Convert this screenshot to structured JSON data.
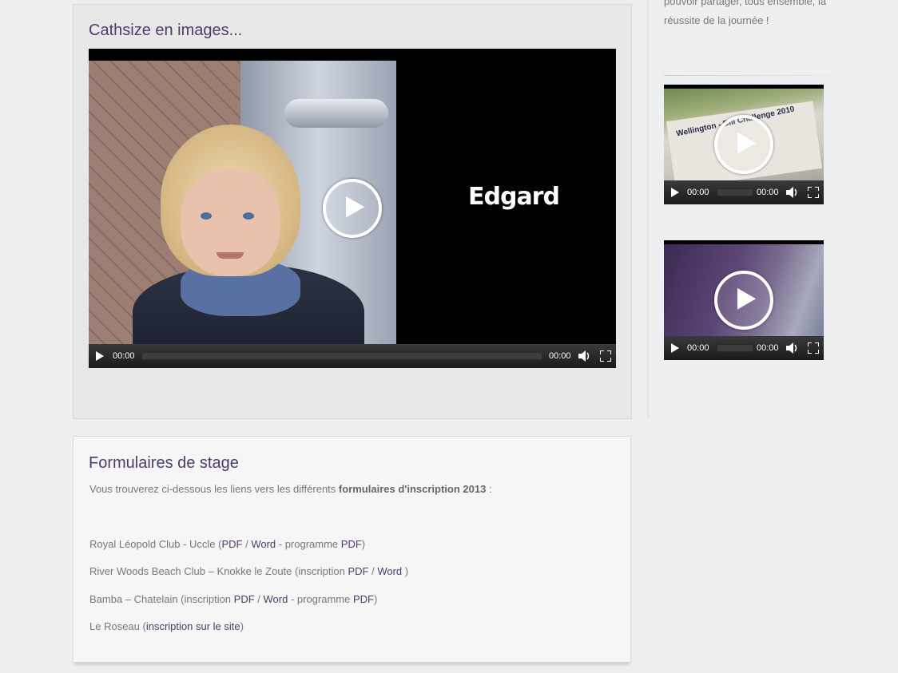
{
  "sidebar": {
    "text_lines": [
      "pouvoir partager, tous ensemble, la",
      "réussite de la journée !"
    ]
  },
  "video_section": {
    "title": "Cathsize en images...",
    "main_video": {
      "overlay_name": "Edgard",
      "current_time": "00:00",
      "duration": "00:00",
      "progress": 0
    }
  },
  "thumbnails": [
    {
      "banner_text": "Wellington - Bill Challenge 2010",
      "current_time": "00:00",
      "duration": "00:00"
    },
    {
      "current_time": "00:00",
      "duration": "00:00"
    }
  ],
  "forms_section": {
    "title": "Formulaires de stage",
    "intro_text": "Vous trouverez ci-dessous les liens vers les différents ",
    "intro_bold": "formulaires d'inscription 2013",
    "intro_end": " :",
    "lines": [
      {
        "prefix": "Royal Léopold Club - Uccle (",
        "link1": "PDF",
        "sep1": " / ",
        "link2": "Word",
        "mid": " - programme ",
        "link3": "PDF",
        "suffix": ")"
      },
      {
        "prefix": "River Woods Beach Club – Knokke le Zoute (inscription ",
        "link1": "PDF",
        "sep1": " / ",
        "link2": "Word",
        "suffix": " )"
      },
      {
        "prefix": "Bamba – Chatelain (inscription ",
        "link1": "PDF",
        "sep1": " / ",
        "link2": "Word",
        "mid": " - programme ",
        "link3": "PDF",
        "suffix": ")"
      },
      {
        "prefix": "Le Roseau (",
        "link1": "inscription sur le site",
        "suffix": ")"
      }
    ]
  },
  "colors": {
    "accent": "#4f3a6e",
    "background": "#eeeff1",
    "text": "#777777"
  }
}
